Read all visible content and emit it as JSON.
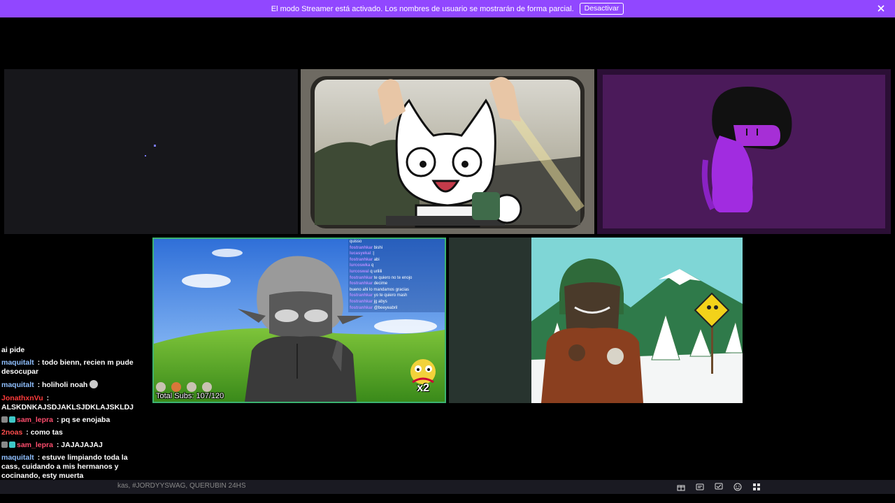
{
  "banner": {
    "message": "El modo Streamer está activado. Los nombres de usuario se mostrarán de forma parcial.",
    "button_label": "Desactivar"
  },
  "tile4": {
    "subs_label": "Total Subs: 107/120",
    "badge": "x2",
    "mini_chat": [
      {
        "user": "",
        "text": "quisso"
      },
      {
        "user": "fostranhkar",
        "text": "bishi"
      },
      {
        "user": "lucasyekal",
        "text": ":|"
      },
      {
        "user": "fostranhkar",
        "text": "abi"
      },
      {
        "user": "lurcoswka",
        "text": "q"
      },
      {
        "user": "lurcoswal",
        "text": "q urilili"
      },
      {
        "user": "fostranhkar",
        "text": "te quiero no te enojo"
      },
      {
        "user": "fostranhkar",
        "text": "decime"
      },
      {
        "user": "",
        "text": "bueno ahi lo mandamos gracias"
      },
      {
        "user": "fostranhkar",
        "text": "yo te quiero mash"
      },
      {
        "user": "fostranhkar",
        "text": "jg abys"
      },
      {
        "user": "fostranhkar",
        "text": "@beeyeabril"
      }
    ]
  },
  "chat": [
    {
      "user": "",
      "text": "ai pide",
      "color": "#ffffff",
      "badges": false
    },
    {
      "user": "maquitalt",
      "text": "todo bienn, recien m pude desocupar",
      "color": "#8fbfff",
      "badges": false
    },
    {
      "user": "maquitalt",
      "text": "holiholi noah",
      "color": "#8fbfff",
      "badges": false
    },
    {
      "user": "JonathxnVu",
      "text": "ALSKDNKAJSDJAKLSJDKLAJSKLDJ",
      "color": "#ff3b3b",
      "badges": false
    },
    {
      "user": "sam_lepra",
      "text": "pq se enojaba",
      "color": "#ff4d6d",
      "badges": true
    },
    {
      "user": "2noas",
      "text": "como tas",
      "color": "#ff4d4d",
      "badges": false
    },
    {
      "user": "sam_lepra",
      "text": "JAJAJAJAJ",
      "color": "#ff4d6d",
      "badges": true
    },
    {
      "user": "maquitalt",
      "text": "estuve limpiando toda la cass, cuidando a mis hermanos y cocinando, esty muerta",
      "color": "#8fbfff",
      "badges": false
    }
  ],
  "bottom": {
    "marquee": "kas, #JORDYYSWAG, QUERUBIN 24HS",
    "icons": [
      "gift-icon",
      "card-icon",
      "chat-check-icon",
      "emote-icon",
      "grid-icon"
    ]
  },
  "colors": {
    "banner": "#9147ff",
    "tile4_border": "#3cb371"
  }
}
